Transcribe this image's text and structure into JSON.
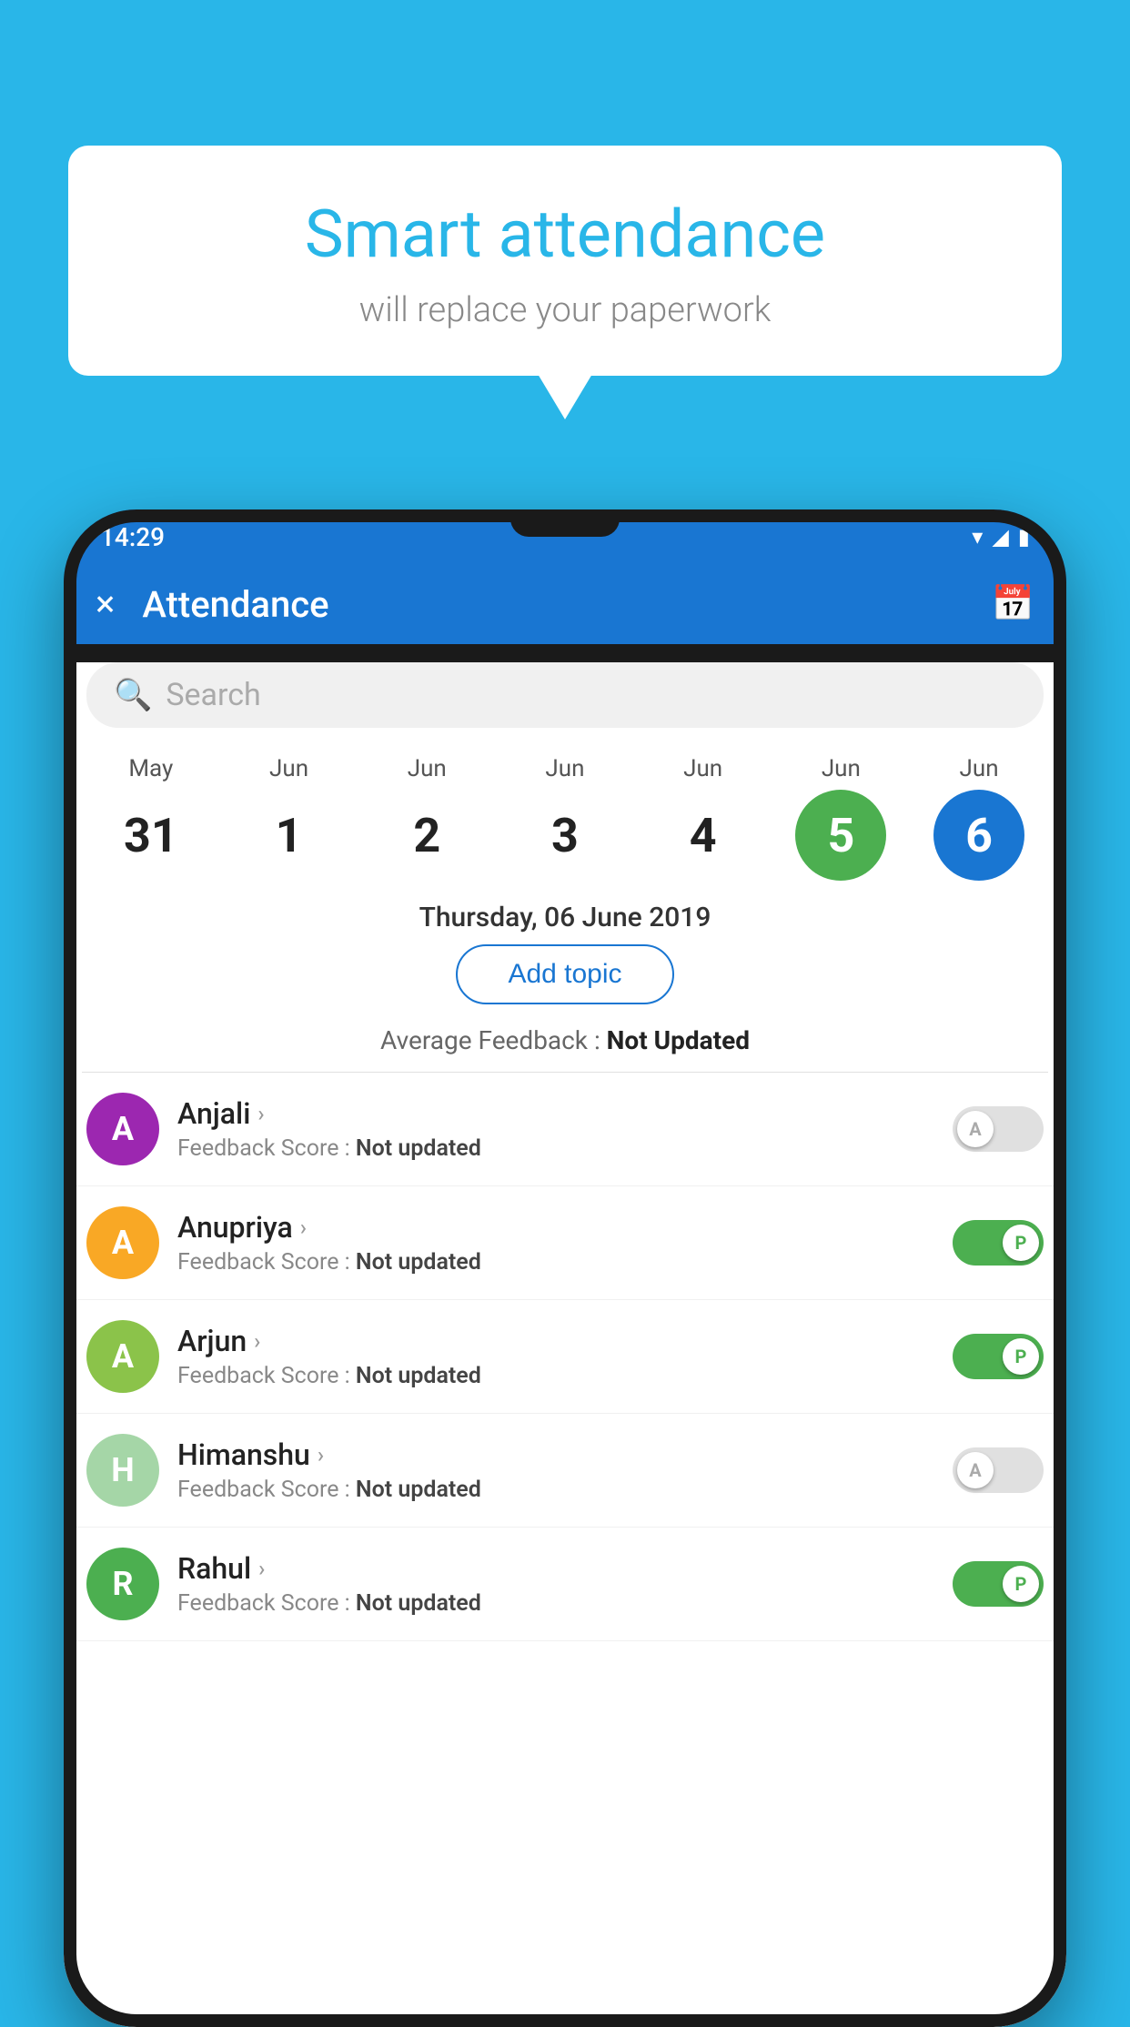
{
  "background": {
    "color": "#29b6e8"
  },
  "bubble": {
    "title": "Smart attendance",
    "subtitle": "will replace your paperwork"
  },
  "phone": {
    "status_bar": {
      "time": "14:29",
      "icons": [
        "wifi",
        "signal",
        "battery"
      ]
    },
    "header": {
      "title": "Attendance",
      "close_label": "×",
      "calendar_icon": "📅"
    },
    "search": {
      "placeholder": "Search"
    },
    "calendar": {
      "days": [
        {
          "month": "May",
          "date": "31",
          "state": "normal"
        },
        {
          "month": "Jun",
          "date": "1",
          "state": "normal"
        },
        {
          "month": "Jun",
          "date": "2",
          "state": "normal"
        },
        {
          "month": "Jun",
          "date": "3",
          "state": "normal"
        },
        {
          "month": "Jun",
          "date": "4",
          "state": "normal"
        },
        {
          "month": "Jun",
          "date": "5",
          "state": "today"
        },
        {
          "month": "Jun",
          "date": "6",
          "state": "selected"
        }
      ]
    },
    "selected_date": "Thursday, 06 June 2019",
    "add_topic_label": "Add topic",
    "avg_feedback_label": "Average Feedback : ",
    "avg_feedback_value": "Not Updated",
    "students": [
      {
        "name": "Anjali",
        "initial": "A",
        "avatar_color": "#9c27b0",
        "feedback": "Not updated",
        "attendance": "A",
        "toggle_state": "off"
      },
      {
        "name": "Anupriya",
        "initial": "A",
        "avatar_color": "#f9a825",
        "feedback": "Not updated",
        "attendance": "P",
        "toggle_state": "on"
      },
      {
        "name": "Arjun",
        "initial": "A",
        "avatar_color": "#8bc34a",
        "feedback": "Not updated",
        "attendance": "P",
        "toggle_state": "on"
      },
      {
        "name": "Himanshu",
        "initial": "H",
        "avatar_color": "#a5d6a7",
        "feedback": "Not updated",
        "attendance": "A",
        "toggle_state": "off"
      },
      {
        "name": "Rahul",
        "initial": "R",
        "avatar_color": "#4caf50",
        "feedback": "Not updated",
        "attendance": "P",
        "toggle_state": "on"
      }
    ]
  }
}
